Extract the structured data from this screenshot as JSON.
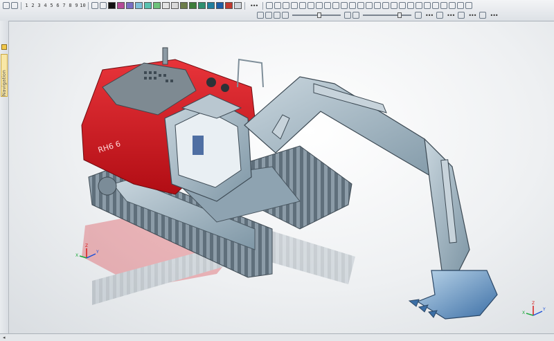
{
  "toolbar": {
    "layer_numbers": [
      "1",
      "2",
      "3",
      "4",
      "5",
      "6",
      "7",
      "8",
      "9",
      "10"
    ],
    "colors": [
      "#111111",
      "#b64a96",
      "#7a6fc4",
      "#7fc0d8",
      "#59c2b0",
      "#6ec27a",
      "#e3e3e3",
      "#d9d9d9",
      "#6c7c4a",
      "#3d7c3a",
      "#2e8f6f",
      "#1f7f9e",
      "#1a5ea8",
      "#c03a2f",
      "#d0d6dc"
    ]
  },
  "sidepanel": {
    "tab_label": "Navigation"
  },
  "viewport": {
    "model_label": "RH6 6",
    "axes": {
      "x": "X",
      "y": "Y",
      "z": "Z"
    },
    "colors": {
      "body": "#d8121c",
      "metal": "#9eb2be",
      "track": "#7b8c98"
    }
  }
}
